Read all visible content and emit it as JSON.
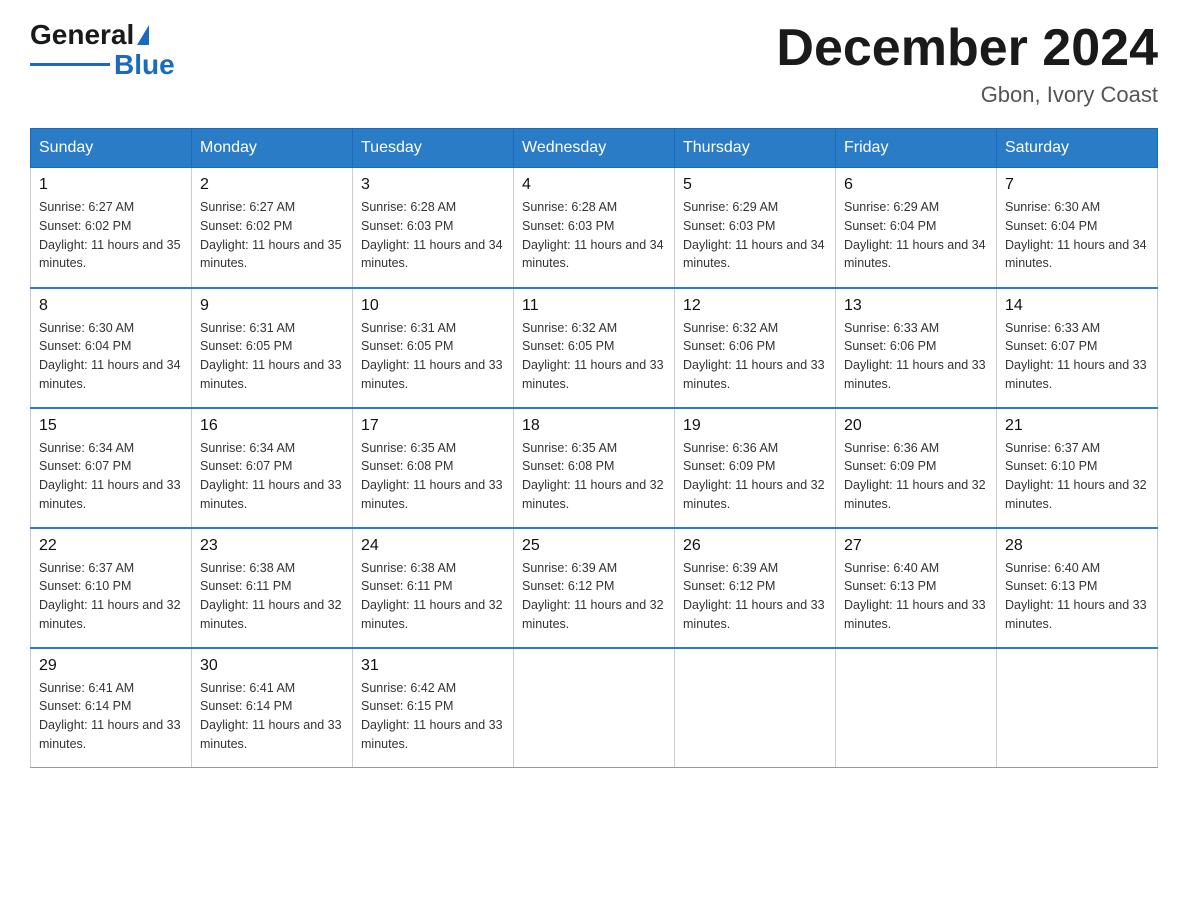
{
  "header": {
    "logo": {
      "general": "General",
      "blue": "Blue",
      "tagline": "GeneralBlue"
    },
    "title": "December 2024",
    "location": "Gbon, Ivory Coast"
  },
  "days_of_week": [
    "Sunday",
    "Monday",
    "Tuesday",
    "Wednesday",
    "Thursday",
    "Friday",
    "Saturday"
  ],
  "weeks": [
    [
      {
        "day": 1,
        "sunrise": "6:27 AM",
        "sunset": "6:02 PM",
        "daylight": "11 hours and 35 minutes."
      },
      {
        "day": 2,
        "sunrise": "6:27 AM",
        "sunset": "6:02 PM",
        "daylight": "11 hours and 35 minutes."
      },
      {
        "day": 3,
        "sunrise": "6:28 AM",
        "sunset": "6:03 PM",
        "daylight": "11 hours and 34 minutes."
      },
      {
        "day": 4,
        "sunrise": "6:28 AM",
        "sunset": "6:03 PM",
        "daylight": "11 hours and 34 minutes."
      },
      {
        "day": 5,
        "sunrise": "6:29 AM",
        "sunset": "6:03 PM",
        "daylight": "11 hours and 34 minutes."
      },
      {
        "day": 6,
        "sunrise": "6:29 AM",
        "sunset": "6:04 PM",
        "daylight": "11 hours and 34 minutes."
      },
      {
        "day": 7,
        "sunrise": "6:30 AM",
        "sunset": "6:04 PM",
        "daylight": "11 hours and 34 minutes."
      }
    ],
    [
      {
        "day": 8,
        "sunrise": "6:30 AM",
        "sunset": "6:04 PM",
        "daylight": "11 hours and 34 minutes."
      },
      {
        "day": 9,
        "sunrise": "6:31 AM",
        "sunset": "6:05 PM",
        "daylight": "11 hours and 33 minutes."
      },
      {
        "day": 10,
        "sunrise": "6:31 AM",
        "sunset": "6:05 PM",
        "daylight": "11 hours and 33 minutes."
      },
      {
        "day": 11,
        "sunrise": "6:32 AM",
        "sunset": "6:05 PM",
        "daylight": "11 hours and 33 minutes."
      },
      {
        "day": 12,
        "sunrise": "6:32 AM",
        "sunset": "6:06 PM",
        "daylight": "11 hours and 33 minutes."
      },
      {
        "day": 13,
        "sunrise": "6:33 AM",
        "sunset": "6:06 PM",
        "daylight": "11 hours and 33 minutes."
      },
      {
        "day": 14,
        "sunrise": "6:33 AM",
        "sunset": "6:07 PM",
        "daylight": "11 hours and 33 minutes."
      }
    ],
    [
      {
        "day": 15,
        "sunrise": "6:34 AM",
        "sunset": "6:07 PM",
        "daylight": "11 hours and 33 minutes."
      },
      {
        "day": 16,
        "sunrise": "6:34 AM",
        "sunset": "6:07 PM",
        "daylight": "11 hours and 33 minutes."
      },
      {
        "day": 17,
        "sunrise": "6:35 AM",
        "sunset": "6:08 PM",
        "daylight": "11 hours and 33 minutes."
      },
      {
        "day": 18,
        "sunrise": "6:35 AM",
        "sunset": "6:08 PM",
        "daylight": "11 hours and 32 minutes."
      },
      {
        "day": 19,
        "sunrise": "6:36 AM",
        "sunset": "6:09 PM",
        "daylight": "11 hours and 32 minutes."
      },
      {
        "day": 20,
        "sunrise": "6:36 AM",
        "sunset": "6:09 PM",
        "daylight": "11 hours and 32 minutes."
      },
      {
        "day": 21,
        "sunrise": "6:37 AM",
        "sunset": "6:10 PM",
        "daylight": "11 hours and 32 minutes."
      }
    ],
    [
      {
        "day": 22,
        "sunrise": "6:37 AM",
        "sunset": "6:10 PM",
        "daylight": "11 hours and 32 minutes."
      },
      {
        "day": 23,
        "sunrise": "6:38 AM",
        "sunset": "6:11 PM",
        "daylight": "11 hours and 32 minutes."
      },
      {
        "day": 24,
        "sunrise": "6:38 AM",
        "sunset": "6:11 PM",
        "daylight": "11 hours and 32 minutes."
      },
      {
        "day": 25,
        "sunrise": "6:39 AM",
        "sunset": "6:12 PM",
        "daylight": "11 hours and 32 minutes."
      },
      {
        "day": 26,
        "sunrise": "6:39 AM",
        "sunset": "6:12 PM",
        "daylight": "11 hours and 33 minutes."
      },
      {
        "day": 27,
        "sunrise": "6:40 AM",
        "sunset": "6:13 PM",
        "daylight": "11 hours and 33 minutes."
      },
      {
        "day": 28,
        "sunrise": "6:40 AM",
        "sunset": "6:13 PM",
        "daylight": "11 hours and 33 minutes."
      }
    ],
    [
      {
        "day": 29,
        "sunrise": "6:41 AM",
        "sunset": "6:14 PM",
        "daylight": "11 hours and 33 minutes."
      },
      {
        "day": 30,
        "sunrise": "6:41 AM",
        "sunset": "6:14 PM",
        "daylight": "11 hours and 33 minutes."
      },
      {
        "day": 31,
        "sunrise": "6:42 AM",
        "sunset": "6:15 PM",
        "daylight": "11 hours and 33 minutes."
      },
      null,
      null,
      null,
      null
    ]
  ]
}
